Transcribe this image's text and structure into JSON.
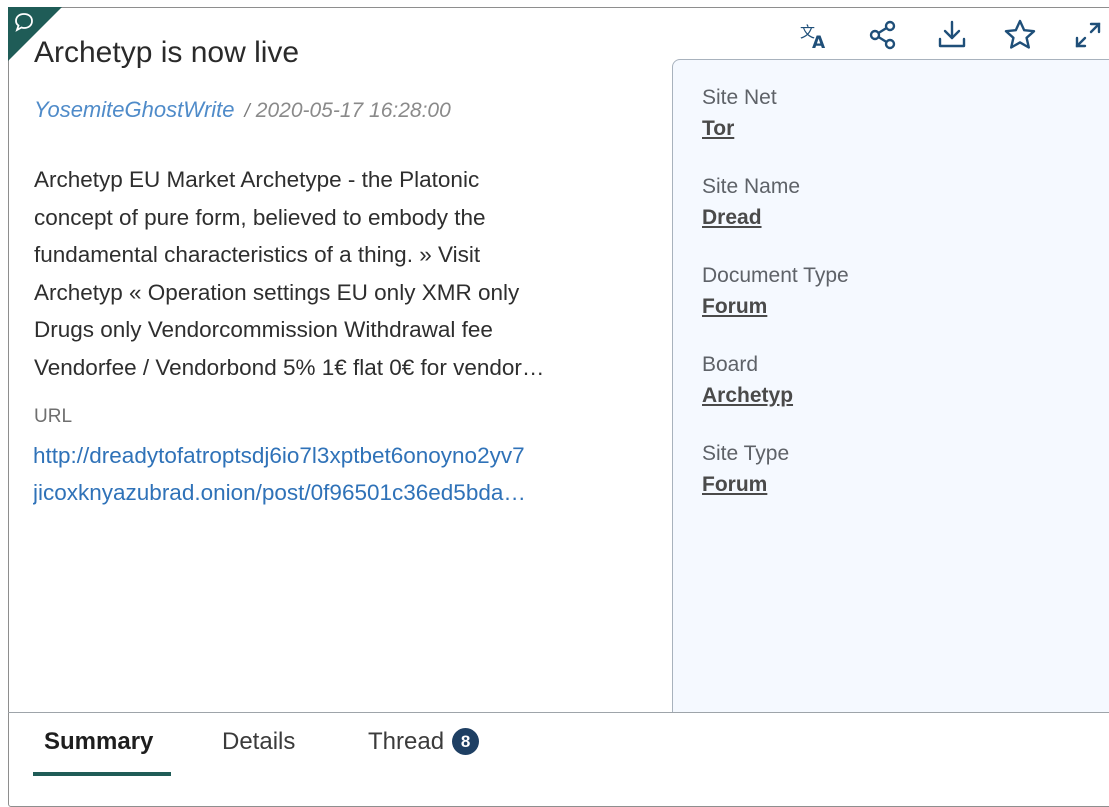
{
  "post": {
    "title": "Archetyp is now live",
    "author": "YosemiteGhostWrite",
    "separator": "/",
    "date": "2020-05-17 16:28:00",
    "body_lines": [
      "Archetyp EU Market Archetype - the Platonic",
      "concept of pure form, believed to embody the",
      "fundamental characteristics of a thing. » Visit",
      "Archetyp « Operation settings EU only XMR only",
      "Drugs only Vendorcommission Withdrawal fee",
      "Vendorfee / Vendorbond 5% 1€ flat 0€ for vendor…"
    ],
    "url_label": "URL",
    "url_lines": [
      "http://dreadytofatroptsdj6io7l3xptbet6onoyno2yv7",
      "jicoxknyazubrad.onion/post/0f96501c36ed5bda…"
    ]
  },
  "toolbar": {
    "icons": [
      "translate-icon",
      "share-icon",
      "download-icon",
      "star-icon",
      "expand-icon"
    ]
  },
  "details": {
    "fields": [
      {
        "label": "Site Net",
        "value": "Tor"
      },
      {
        "label": "Site Name",
        "value": "Dread"
      },
      {
        "label": "Document Type",
        "value": "Forum"
      },
      {
        "label": "Board",
        "value": "Archetyp"
      },
      {
        "label": "Site Type",
        "value": "Forum"
      }
    ]
  },
  "tabs": [
    {
      "label": "Summary",
      "active": true
    },
    {
      "label": "Details",
      "active": false
    },
    {
      "label": "Thread",
      "badge": "8",
      "active": false
    }
  ],
  "colors": {
    "accent": "#1f5c57",
    "link": "#2f72b8",
    "author": "#4f8bc9",
    "badge": "#1e3f63",
    "panel": "#f5f9ff"
  }
}
